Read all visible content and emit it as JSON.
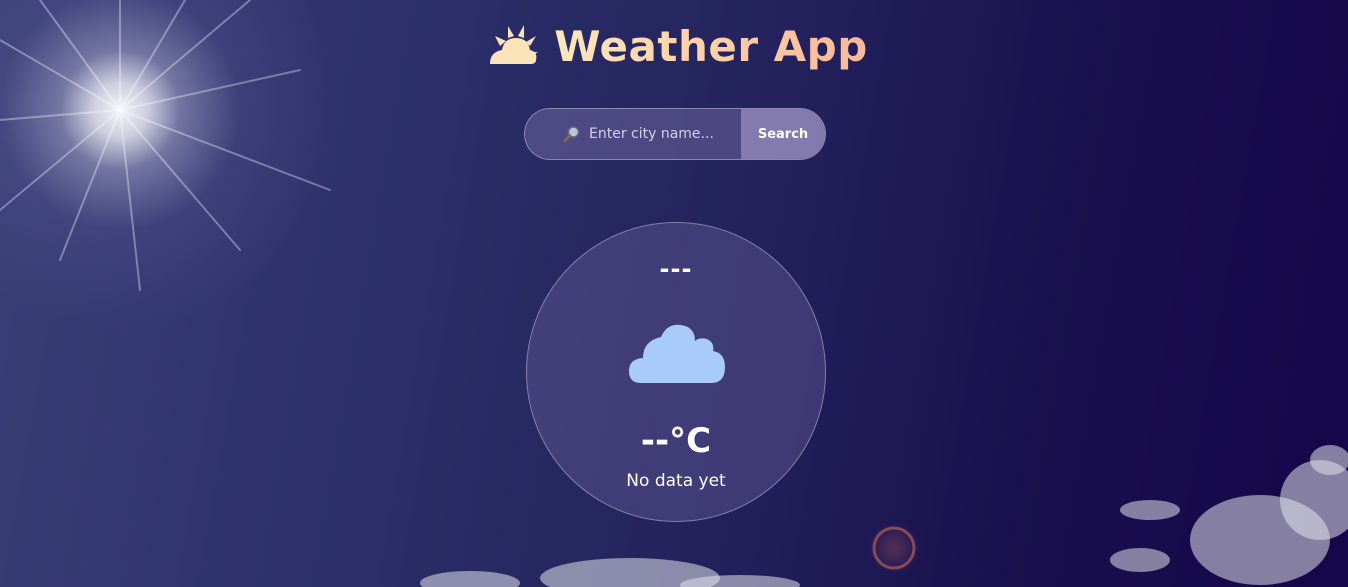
{
  "app": {
    "title": "Weather App",
    "title_icon": "sun-behind-cloud-icon"
  },
  "search": {
    "icon": "magnifier-icon",
    "placeholder": "Enter city name...",
    "value": "",
    "button_label": "Search"
  },
  "weather": {
    "city": "---",
    "icon": "cloud-icon",
    "temperature": "--°C",
    "description": "No data yet"
  },
  "colors": {
    "title_gradient_start": "#fde6bd",
    "title_gradient_end": "#f9b89a",
    "cloud_icon": "#a9cbfb",
    "background_dark": "#14074a"
  }
}
